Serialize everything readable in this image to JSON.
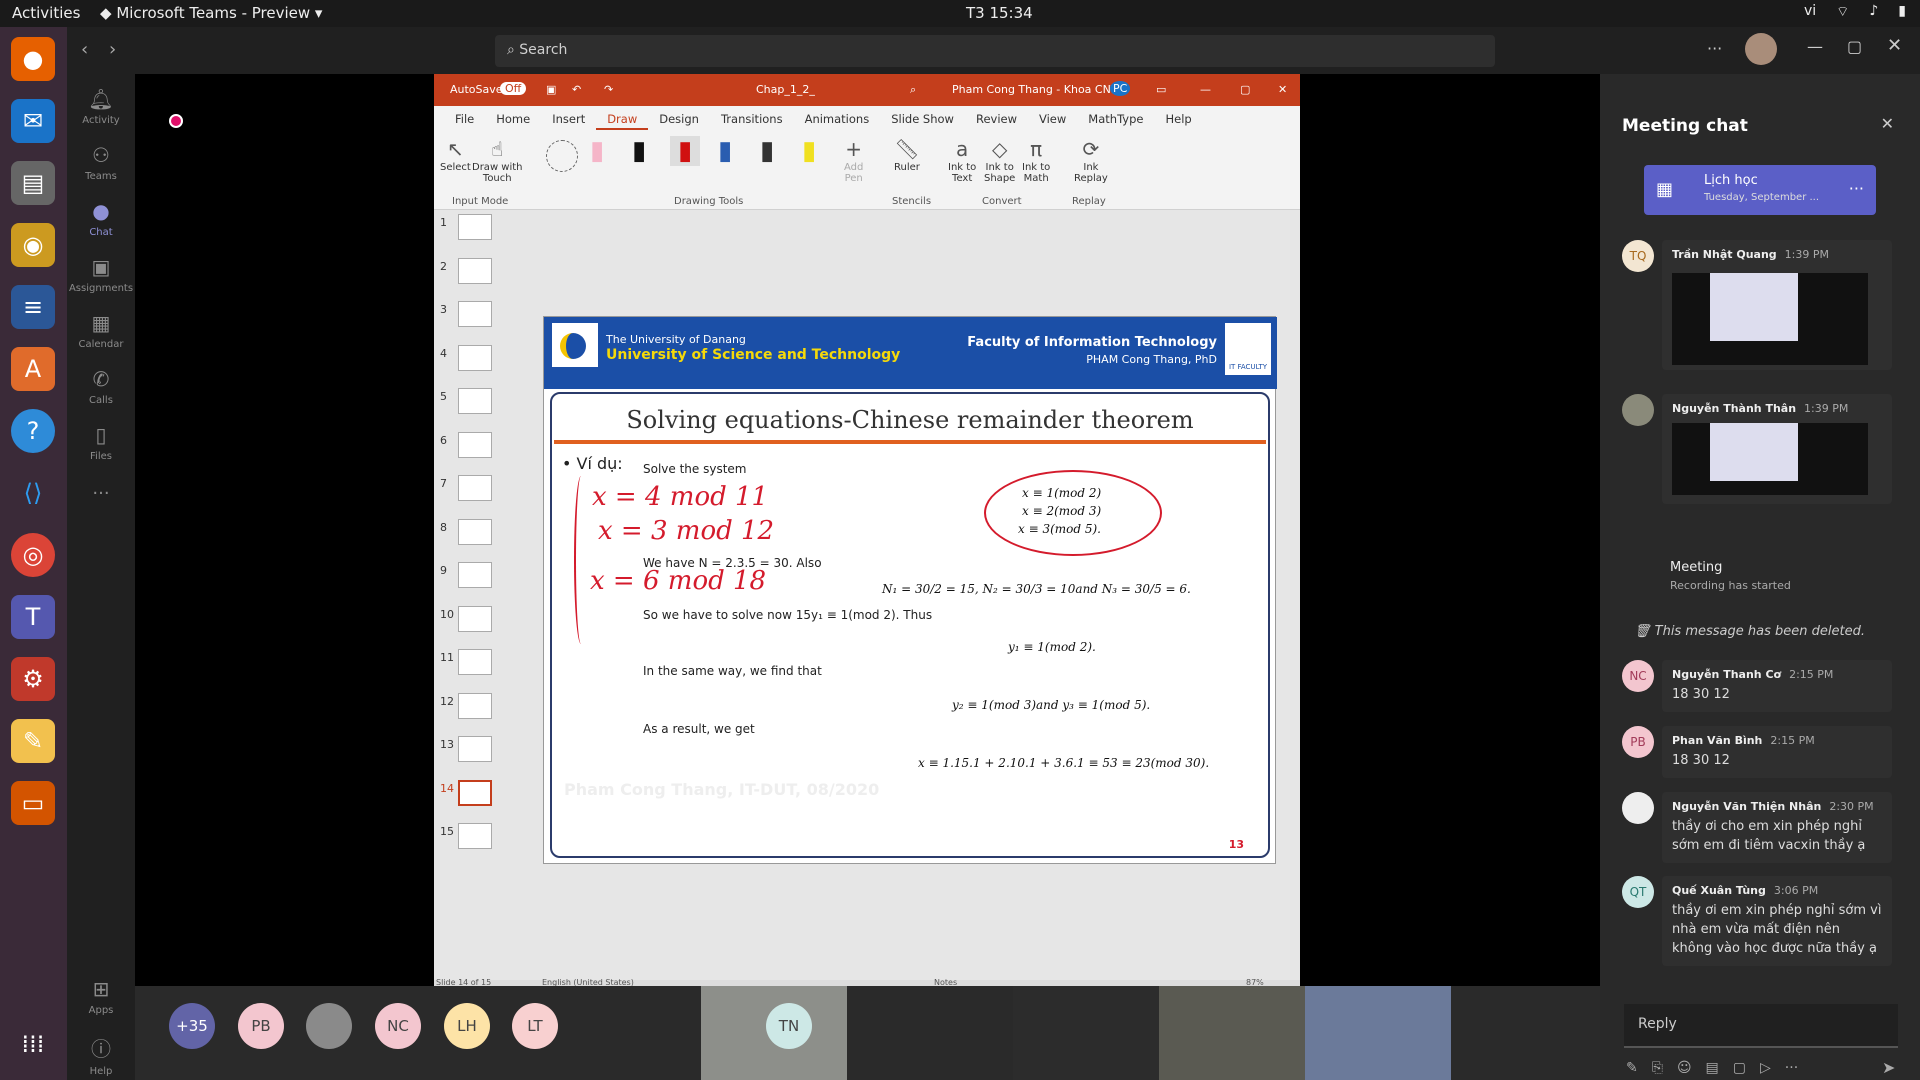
{
  "topbar": {
    "activities": "Activities",
    "app_name": "Microsoft Teams - Preview",
    "clock": "T3 15:34",
    "lang": "vi"
  },
  "rail": [
    "Activity",
    "Teams",
    "Chat",
    "Assignments",
    "Calendar",
    "Calls",
    "Files",
    "Apps",
    "Help"
  ],
  "search": {
    "placeholder": "Search"
  },
  "ppt": {
    "autosave": "AutoSave",
    "autosave_state": "Off",
    "filename": "Chap_1_2_",
    "user": "Pham Cong Thang - Khoa CNTT",
    "user_initials": "PC",
    "menus": [
      "File",
      "Home",
      "Insert",
      "Draw",
      "Design",
      "Transitions",
      "Animations",
      "Slide Show",
      "Review",
      "View",
      "MathType",
      "Help"
    ],
    "ribbon": {
      "select": "Select",
      "draw_touch_1": "Draw with",
      "draw_touch_2": "Touch",
      "input_mode": "Input Mode",
      "drawing_tools": "Drawing Tools",
      "add_pen_1": "Add",
      "add_pen_2": "Pen",
      "ruler": "Ruler",
      "stencils": "Stencils",
      "ink_text_1": "Ink to",
      "ink_text_2": "Text",
      "ink_shape_1": "Ink to",
      "ink_shape_2": "Shape",
      "ink_math_1": "Ink to",
      "ink_math_2": "Math",
      "convert": "Convert",
      "ink_replay_1": "Ink",
      "ink_replay_2": "Replay",
      "replay": "Replay"
    },
    "thumbs": [
      "1",
      "2",
      "3",
      "4",
      "5",
      "6",
      "7",
      "8",
      "9",
      "10",
      "11",
      "12",
      "13",
      "14",
      "15"
    ],
    "status": {
      "slide": "Slide 14 of 15",
      "lang": "English (United States)",
      "notes": "Notes",
      "zoom": "87%"
    }
  },
  "slide": {
    "uni_1": "The University of Danang",
    "uni_2": "University of Science and Technology",
    "faculty": "Faculty of Information Technology",
    "author": "PHAM Cong Thang, PhD",
    "logo_text": "IT FACULTY",
    "title": "Solving equations-Chinese remainder theorem",
    "bullet": "Ví dụ:",
    "solve": "Solve the system",
    "eq1": "x ≡ 1(mod 2)",
    "eq2": "x ≡ 2(mod 3)",
    "eq3": "x ≡ 3(mod 5).",
    "we_have": "We have N = 2.3.5 = 30. Also",
    "n_line": "N₁ = 30/2 = 15, N₂ = 30/3 = 10and  N₃ = 30/5 = 6.",
    "so_we": "So we have to solve now 15y₁ ≡ 1(mod 2). Thus",
    "y1": "y₁ ≡ 1(mod 2).",
    "same_way": "In the same way, we find that",
    "y23": "y₂ ≡ 1(mod 3)and  y₃ ≡ 1(mod 5).",
    "result": "As a result, we get",
    "final": "x ≡ 1.15.1 + 2.10.1 + 3.6.1 ≡ 53 ≡ 23(mod 30).",
    "watermark": "Pham Cong Thang, IT-DUT, 08/2020",
    "page": "13",
    "ink_1": "x = 4 mod 11",
    "ink_2": "x = 3 mod 12",
    "ink_3": "x = 6 mod 18"
  },
  "participants": [
    {
      "initials": "+35",
      "color": "#6264a7"
    },
    {
      "initials": "PB",
      "color": "#f3c6cf"
    },
    {
      "initials": "",
      "color": "#8a8a8a"
    },
    {
      "initials": "NC",
      "color": "#f3c6cf"
    },
    {
      "initials": "LH",
      "color": "#fde3a7"
    },
    {
      "initials": "LT",
      "color": "#f8d0d0"
    },
    {
      "initials": "TN",
      "color": "#cde8e6"
    }
  ],
  "chat": {
    "title": "Meeting chat",
    "event_title": "Lịch học",
    "event_sub": "Tuesday, September ...",
    "m1": {
      "initials": "TQ",
      "name": "Trần Nhật Quang",
      "time": "1:39 PM"
    },
    "m2": {
      "initials": "",
      "name": "Nguyễn Thành Thân",
      "time": "1:39 PM"
    },
    "meeting": "Meeting",
    "recording": "Recording has started",
    "deleted": "This message has been deleted.",
    "m3": {
      "initials": "NC",
      "name": "Nguyễn Thanh Cơ",
      "time": "2:15 PM",
      "text": "18 30 12"
    },
    "m4": {
      "initials": "PB",
      "name": "Phan Văn Bình",
      "time": "2:15 PM",
      "text": "18 30 12"
    },
    "m5": {
      "initials": "",
      "name": "Nguyễn Văn Thiện Nhân",
      "time": "2:30 PM",
      "text": "thầy ơi cho em xin phép nghỉ sớm em đi tiêm vacxin thầy ạ"
    },
    "m6": {
      "initials": "QT",
      "name": "Quế Xuân Tùng",
      "time": "3:06 PM",
      "text": "thầy ơi em xin phép nghỉ sớm vì nhà em vừa mất điện nên không vào học được nữa thầy ạ"
    },
    "reply": "Reply"
  }
}
